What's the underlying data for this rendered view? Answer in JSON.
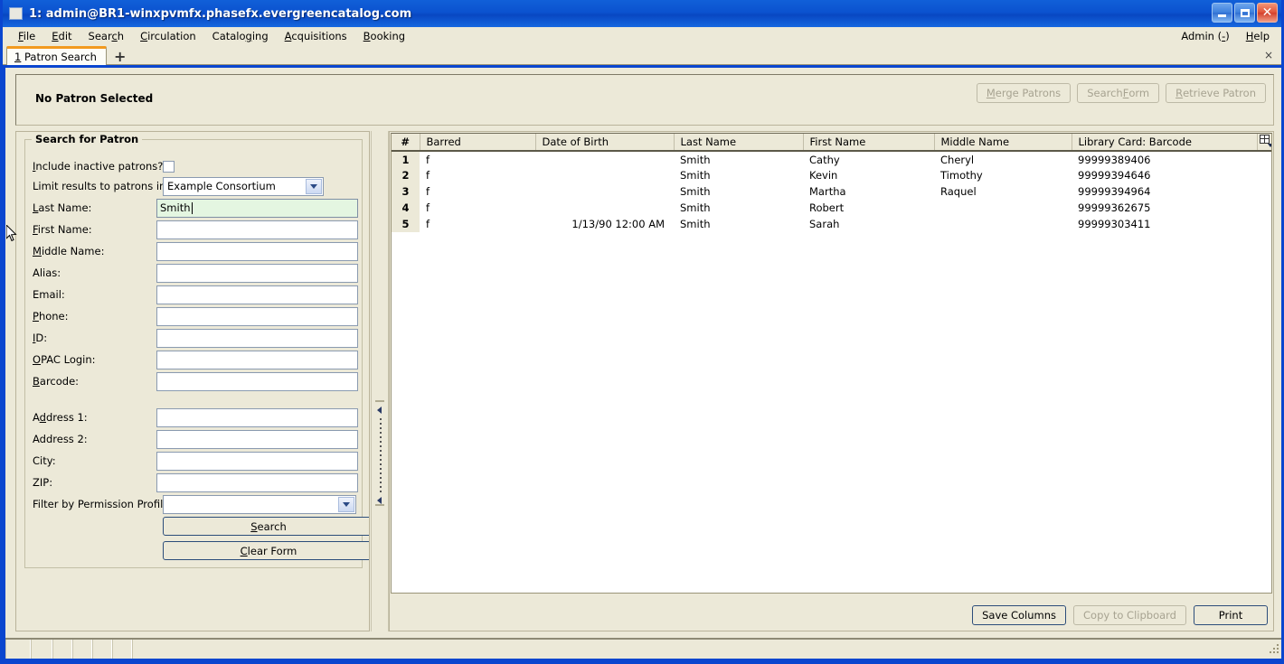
{
  "window": {
    "title": "1: admin@BR1-winxpvmfx.phasefx.evergreencatalog.com",
    "sysicon": "window-icon",
    "minimize": "–",
    "maximize": "□",
    "close": "✕",
    "titlebar_color": "#0b52cf"
  },
  "menubar": {
    "items": [
      {
        "label": "File",
        "accel": "F"
      },
      {
        "label": "Edit",
        "accel": "E"
      },
      {
        "label": "Search",
        "accel": "c"
      },
      {
        "label": "Circulation",
        "accel": "C"
      },
      {
        "label": "Cataloging",
        "accel": "g"
      },
      {
        "label": "Acquisitions",
        "accel": "A"
      },
      {
        "label": "Booking",
        "accel": "B"
      }
    ],
    "right_items": [
      {
        "label": "Admin (-)",
        "accel": "-"
      },
      {
        "label": "Help",
        "accel": "H"
      }
    ]
  },
  "tabs": {
    "active": {
      "number": "1",
      "label": "Patron Search"
    },
    "new_tab_label": "+",
    "close_label": "×"
  },
  "patron_bar": {
    "status": "No Patron Selected",
    "buttons": [
      {
        "label": "Merge Patrons",
        "accel": "M",
        "enabled": false
      },
      {
        "label": "Search Form",
        "accel": "F",
        "enabled": false
      },
      {
        "label": "Retrieve Patron",
        "accel": "R",
        "enabled": false
      }
    ]
  },
  "search_form": {
    "legend": "Search for Patron",
    "include_inactive": {
      "label": "Include inactive patrons?",
      "accel": "I",
      "checked": false
    },
    "limit_org": {
      "label": "Limit results to patrons in",
      "value": "Example Consortium"
    },
    "fields": [
      {
        "label": "Last Name:",
        "accel": "L",
        "value": "Smith",
        "focused": true
      },
      {
        "label": "First Name:",
        "accel": "F",
        "value": "",
        "focused": false
      },
      {
        "label": "Middle Name:",
        "accel": "M",
        "value": "",
        "focused": false
      },
      {
        "label": "Alias:",
        "accel": "",
        "value": "",
        "focused": false
      },
      {
        "label": "Email:",
        "accel": "",
        "value": "",
        "focused": false
      },
      {
        "label": "Phone:",
        "accel": "P",
        "value": "",
        "focused": false
      },
      {
        "label": "ID:",
        "accel": "I",
        "value": "",
        "focused": false
      },
      {
        "label": "OPAC Login:",
        "accel": "O",
        "value": "",
        "focused": false
      },
      {
        "label": "Barcode:",
        "accel": "B",
        "value": "",
        "focused": false
      }
    ],
    "address_fields": [
      {
        "label": "Address 1:",
        "accel": "d",
        "value": ""
      },
      {
        "label": "Address 2:",
        "accel": "",
        "value": ""
      },
      {
        "label": "City:",
        "accel": "",
        "value": ""
      },
      {
        "label": "ZIP:",
        "accel": "",
        "value": ""
      }
    ],
    "permission_profile": {
      "label": "Filter by Permission Profile:",
      "value": ""
    },
    "search_button": {
      "label": "Search",
      "accel": "S"
    },
    "clear_button": {
      "label": "Clear Form",
      "accel": "C"
    }
  },
  "results": {
    "columns": [
      "#",
      "Barred",
      "Date of Birth",
      "Last Name",
      "First Name",
      "Middle Name",
      "Library Card: Barcode"
    ],
    "column_picker_icon": "column-picker-icon",
    "rows": [
      {
        "num": "1",
        "barred": "f",
        "dob": "",
        "last": "Smith",
        "first": "Cathy",
        "middle": "Cheryl",
        "barcode": "99999389406"
      },
      {
        "num": "2",
        "barred": "f",
        "dob": "",
        "last": "Smith",
        "first": "Kevin",
        "middle": "Timothy",
        "barcode": "99999394646"
      },
      {
        "num": "3",
        "barred": "f",
        "dob": "",
        "last": "Smith",
        "first": "Martha",
        "middle": "Raquel",
        "barcode": "99999394964"
      },
      {
        "num": "4",
        "barred": "f",
        "dob": "",
        "last": "Smith",
        "first": "Robert",
        "middle": "",
        "barcode": "99999362675"
      },
      {
        "num": "5",
        "barred": "f",
        "dob": "1/13/90 12:00 AM",
        "last": "Smith",
        "first": "Sarah",
        "middle": "",
        "barcode": "99999303411"
      }
    ],
    "footer_buttons": [
      {
        "label": "Save Columns",
        "enabled": true
      },
      {
        "label": "Copy to Clipboard",
        "enabled": false
      },
      {
        "label": "Print",
        "enabled": true
      }
    ]
  },
  "statusbar": {
    "segments": [
      "",
      "",
      "",
      "",
      "",
      "",
      ""
    ]
  }
}
